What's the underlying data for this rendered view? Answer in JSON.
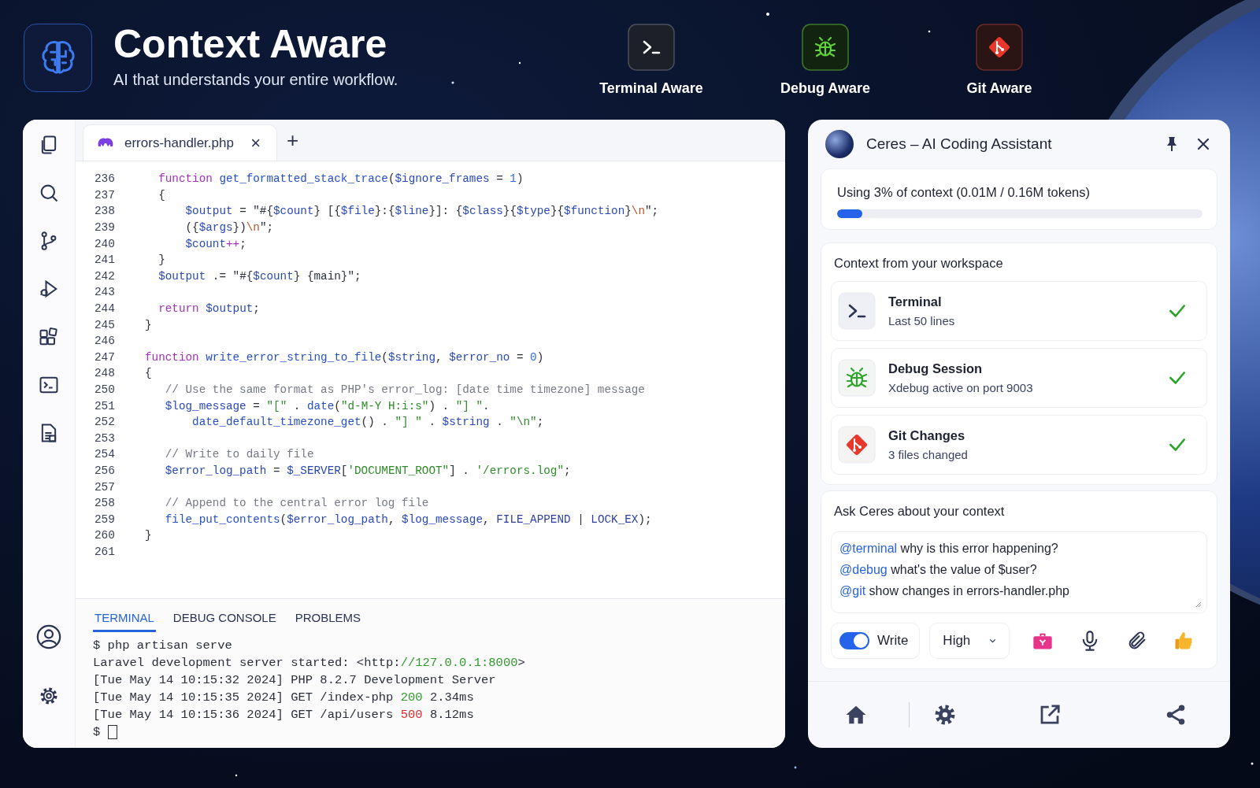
{
  "header": {
    "title": "Context Aware",
    "subtitle": "AI that understands your entire workflow.",
    "features": [
      {
        "kind": "terminal",
        "label": "Terminal Aware"
      },
      {
        "kind": "debug",
        "label": "Debug Aware"
      },
      {
        "kind": "git",
        "label": "Git Aware"
      }
    ]
  },
  "editor": {
    "tabs": [
      {
        "label": "errors-handler.php",
        "selected": true,
        "close": "×"
      }
    ],
    "new_tab": "+",
    "lines": [
      {
        "number": "236",
        "text": "  function get_formatted_stack_trace($ignore_frames = 1)"
      },
      {
        "number": "237",
        "text": "  {"
      },
      {
        "number": "238",
        "text": "      $output = \"#{$count} [{$file}:{$line}]: {$class}{$type}{$function}\\n\";"
      },
      {
        "number": "239",
        "text": "      ({$args})\\n\";"
      },
      {
        "number": "240",
        "text": "      $count++;"
      },
      {
        "number": "241",
        "text": "  }"
      },
      {
        "number": "242",
        "text": "  $output .= \"#{$count} {main}\";"
      },
      {
        "number": "243"
      },
      {
        "number": "244",
        "text": "  return $output;"
      },
      {
        "number": "245",
        "text": "}"
      },
      {
        "number": "246"
      },
      {
        "number": "247",
        "text": "function write_error_string_to_file($string, $error_no = 0)"
      },
      {
        "number": "248",
        "text": "{"
      },
      {
        "number": "250",
        "text": "   // Use the same format as PHP's error_log: [date time timezone] message"
      },
      {
        "number": "251",
        "text": "   $log_message = \"[\" . date(\"d-M-Y H:i:s\") . \"] \"."
      },
      {
        "number": "252",
        "text": "       date_default_timezone_get() . \"] \" . $string . \"\\n\";"
      },
      {
        "number": "253"
      },
      {
        "number": "254",
        "text": "   // Write to daily file"
      },
      {
        "number": "256",
        "text": "   $error_log_path = $_SERVER['DOCUMENT_ROOT\"] . '/errors.log\";"
      },
      {
        "number": "257"
      },
      {
        "number": "258",
        "text": "   // Append to the central error log file"
      },
      {
        "number": "259",
        "text": "   file_put_contents($error_log_path, $log_message, FILE_APPEND | LOCK_EX);"
      },
      {
        "number": "260",
        "text": "}"
      },
      {
        "number": "261"
      }
    ]
  },
  "panel": {
    "tabs": [
      {
        "label": "TERMINAL",
        "selected": true
      },
      {
        "label": "DEBUG CONSOLE",
        "selected": false
      },
      {
        "label": "PROBLEMS",
        "selected": false
      }
    ],
    "lines": [
      "$ php artisan serve",
      "Laravel development server started: <http://127.0.0.1:8000>",
      "[Tue May 14 10:15:32 2024] PHP 8.2.7 Development Server",
      "[Tue May 14 10:15:35 2024] GET /index-php 200 2.34ms",
      "[Tue May 14 10:15:36 2024] GET /api/users 500 8.12ms",
      "$"
    ],
    "cursor": true
  },
  "assistant": {
    "title": "Ceres – AI Coding Assistant",
    "usage": {
      "text": "Using 3% of context (0.01M / 0.16M tokens)",
      "level": 0.07
    },
    "workspace": {
      "heading": "Context from your workspace",
      "items": [
        {
          "kind": "terminal",
          "title": "Terminal",
          "detail": "Last 50 lines",
          "checked": true
        },
        {
          "kind": "debug",
          "title": "Debug Session",
          "detail": "Xdebug active on port 9003",
          "checked": true
        },
        {
          "kind": "git",
          "title": "Git Changes",
          "detail": "3 files changed",
          "checked": true
        }
      ]
    },
    "ask": {
      "heading": "Ask Ceres about your context",
      "prompts": [
        {
          "mention": "@terminal",
          "text": "why is this error happening?"
        },
        {
          "mention": "@debug",
          "text": "what's the value of $user?"
        },
        {
          "mention": "@git",
          "text": "show changes in errors-handler.php"
        }
      ],
      "write_toggle": {
        "label": "Write",
        "on": true
      },
      "effort": {
        "value": "High"
      }
    }
  }
}
